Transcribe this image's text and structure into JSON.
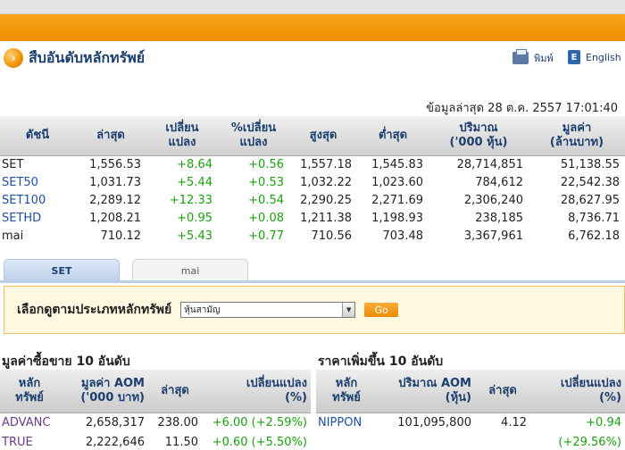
{
  "header": {
    "title": "สืบอันดับหลักทรัพย์",
    "print_label": "พิมพ์",
    "english_label": "English",
    "updated": "ข้อมูลล่าสุด 28 ต.ค. 2557 17:01:40"
  },
  "index_table": {
    "headers": {
      "index": "ดัชนี",
      "last": "ล่าสุด",
      "change": [
        "เปลี่ยน",
        "แปลง"
      ],
      "pct_change": [
        "%เปลี่ยน",
        "แปลง"
      ],
      "high": "สูงสุด",
      "low": "ต่ำสุด",
      "volume": [
        "ปริมาณ",
        "('000 หุ้น)"
      ],
      "value": [
        "มูลค่า",
        "(ล้านบาท)"
      ]
    },
    "rows": [
      {
        "name": "SET",
        "last": "1,556.53",
        "change": "+8.64",
        "pct": "+0.56",
        "high": "1,557.18",
        "low": "1,545.83",
        "volume": "28,714,851",
        "value": "51,138.55"
      },
      {
        "name": "SET50",
        "last": "1,031.73",
        "change": "+5.44",
        "pct": "+0.53",
        "high": "1,032.22",
        "low": "1,023.60",
        "volume": "784,612",
        "value": "22,542.38"
      },
      {
        "name": "SET100",
        "last": "2,289.12",
        "change": "+12.33",
        "pct": "+0.54",
        "high": "2,290.25",
        "low": "2,271.69",
        "volume": "2,306,240",
        "value": "28,627.95"
      },
      {
        "name": "SETHD",
        "last": "1,208.21",
        "change": "+0.95",
        "pct": "+0.08",
        "high": "1,211.38",
        "low": "1,198.93",
        "volume": "238,185",
        "value": "8,736.71"
      },
      {
        "name": "mai",
        "last": "710.12",
        "change": "+5.43",
        "pct": "+0.77",
        "high": "710.56",
        "low": "703.48",
        "volume": "3,367,961",
        "value": "6,762.18"
      }
    ]
  },
  "tabs": [
    {
      "label": "SET"
    },
    {
      "label": "mai"
    }
  ],
  "filter": {
    "label": "เลือกดูตามประเภทหลักทรัพย์",
    "selected": "หุ้นสามัญ",
    "go_label": "Go"
  },
  "top_value": {
    "title": "มูลค่าซื้อขาย 10 อันดับ",
    "headers": {
      "stock": [
        "หลัก",
        "ทรัพย์"
      ],
      "aom": [
        "มูลค่า AOM",
        "('000 บาท)"
      ],
      "last": "ล่าสุด",
      "change": [
        "เปลี่ยนแปลง",
        "(%)"
      ]
    },
    "rows": [
      {
        "stock": "ADVANC",
        "aom": "2,658,317",
        "last": "238.00",
        "change": "+6.00 (+2.59%)"
      },
      {
        "stock": "TRUE",
        "aom": "2,222,646",
        "last": "11.50",
        "change": "+0.60 (+5.50%)"
      }
    ]
  },
  "top_gainers": {
    "title": "ราคาเพิ่มขึ้น 10 อันดับ",
    "headers": {
      "stock": [
        "หลัก",
        "ทรัพย์"
      ],
      "aom": [
        "ปริมาณ AOM",
        "(หุ้น)"
      ],
      "last": "ล่าสุด",
      "change": [
        "เปลี่ยนแปลง",
        "(%)"
      ]
    },
    "rows": [
      {
        "stock": "NIPPON",
        "aom": "101,095,800",
        "last": "4.12",
        "change": "+0.94"
      },
      {
        "stock": "",
        "aom": "",
        "last": "",
        "change": "(+29.56%)"
      }
    ]
  },
  "colors": {
    "accent_orange": "#f08c00",
    "positive": "#1aa010",
    "link": "#1f4fa0",
    "header_text": "#1b3f6e"
  }
}
